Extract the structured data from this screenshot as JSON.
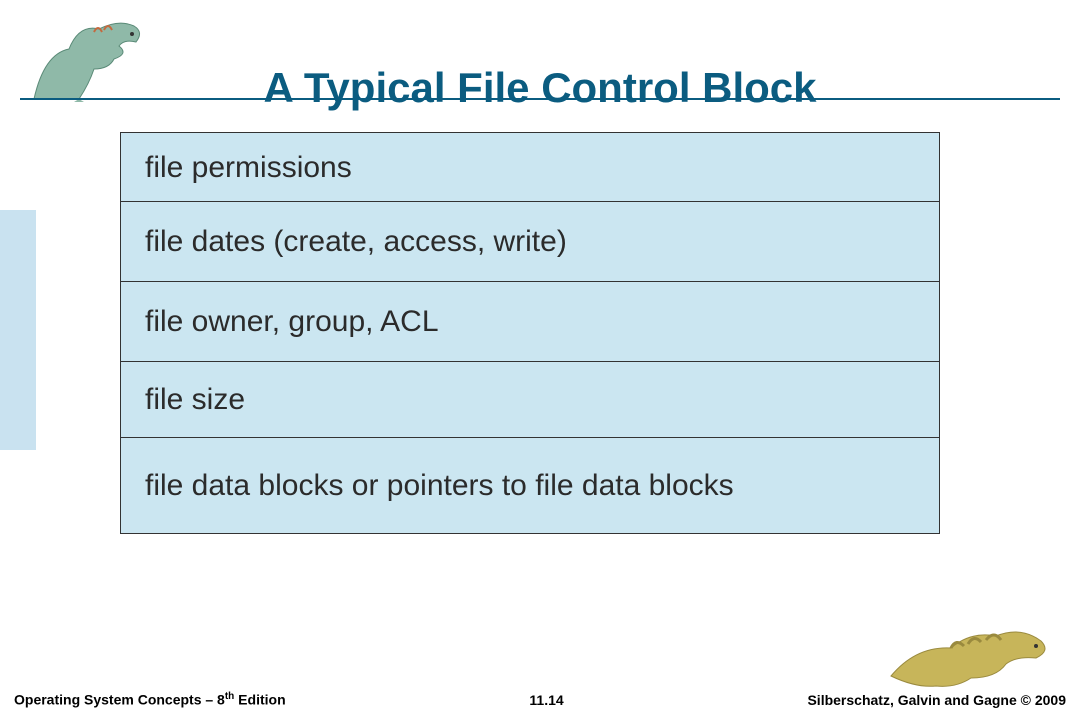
{
  "title": "A Typical File Control Block",
  "rows": {
    "r1": "file permissions",
    "r2": "file dates (create, access, write)",
    "r3": "file owner, group, ACL",
    "r4": "file size",
    "r5": "file data blocks or pointers to file data blocks"
  },
  "footer": {
    "left_prefix": "Operating System Concepts – 8",
    "left_suffix": " Edition",
    "left_sup": "th",
    "center": "11.14",
    "right": "Silberschatz, Galvin and Gagne © 2009"
  }
}
